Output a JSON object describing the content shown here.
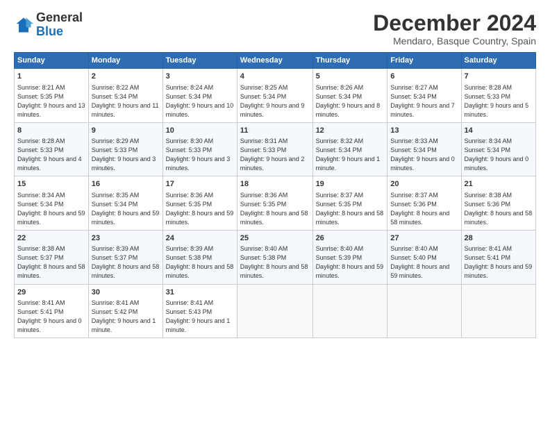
{
  "logo": {
    "line1": "General",
    "line2": "Blue"
  },
  "title": "December 2024",
  "subtitle": "Mendaro, Basque Country, Spain",
  "weekdays": [
    "Sunday",
    "Monday",
    "Tuesday",
    "Wednesday",
    "Thursday",
    "Friday",
    "Saturday"
  ],
  "weeks": [
    [
      {
        "day": "1",
        "content": "Sunrise: 8:21 AM\nSunset: 5:35 PM\nDaylight: 9 hours and 13 minutes."
      },
      {
        "day": "2",
        "content": "Sunrise: 8:22 AM\nSunset: 5:34 PM\nDaylight: 9 hours and 11 minutes."
      },
      {
        "day": "3",
        "content": "Sunrise: 8:24 AM\nSunset: 5:34 PM\nDaylight: 9 hours and 10 minutes."
      },
      {
        "day": "4",
        "content": "Sunrise: 8:25 AM\nSunset: 5:34 PM\nDaylight: 9 hours and 9 minutes."
      },
      {
        "day": "5",
        "content": "Sunrise: 8:26 AM\nSunset: 5:34 PM\nDaylight: 9 hours and 8 minutes."
      },
      {
        "day": "6",
        "content": "Sunrise: 8:27 AM\nSunset: 5:34 PM\nDaylight: 9 hours and 7 minutes."
      },
      {
        "day": "7",
        "content": "Sunrise: 8:28 AM\nSunset: 5:33 PM\nDaylight: 9 hours and 5 minutes."
      }
    ],
    [
      {
        "day": "8",
        "content": "Sunrise: 8:28 AM\nSunset: 5:33 PM\nDaylight: 9 hours and 4 minutes."
      },
      {
        "day": "9",
        "content": "Sunrise: 8:29 AM\nSunset: 5:33 PM\nDaylight: 9 hours and 3 minutes."
      },
      {
        "day": "10",
        "content": "Sunrise: 8:30 AM\nSunset: 5:33 PM\nDaylight: 9 hours and 3 minutes."
      },
      {
        "day": "11",
        "content": "Sunrise: 8:31 AM\nSunset: 5:33 PM\nDaylight: 9 hours and 2 minutes."
      },
      {
        "day": "12",
        "content": "Sunrise: 8:32 AM\nSunset: 5:34 PM\nDaylight: 9 hours and 1 minute."
      },
      {
        "day": "13",
        "content": "Sunrise: 8:33 AM\nSunset: 5:34 PM\nDaylight: 9 hours and 0 minutes."
      },
      {
        "day": "14",
        "content": "Sunrise: 8:34 AM\nSunset: 5:34 PM\nDaylight: 9 hours and 0 minutes."
      }
    ],
    [
      {
        "day": "15",
        "content": "Sunrise: 8:34 AM\nSunset: 5:34 PM\nDaylight: 8 hours and 59 minutes."
      },
      {
        "day": "16",
        "content": "Sunrise: 8:35 AM\nSunset: 5:34 PM\nDaylight: 8 hours and 59 minutes."
      },
      {
        "day": "17",
        "content": "Sunrise: 8:36 AM\nSunset: 5:35 PM\nDaylight: 8 hours and 59 minutes."
      },
      {
        "day": "18",
        "content": "Sunrise: 8:36 AM\nSunset: 5:35 PM\nDaylight: 8 hours and 58 minutes."
      },
      {
        "day": "19",
        "content": "Sunrise: 8:37 AM\nSunset: 5:35 PM\nDaylight: 8 hours and 58 minutes."
      },
      {
        "day": "20",
        "content": "Sunrise: 8:37 AM\nSunset: 5:36 PM\nDaylight: 8 hours and 58 minutes."
      },
      {
        "day": "21",
        "content": "Sunrise: 8:38 AM\nSunset: 5:36 PM\nDaylight: 8 hours and 58 minutes."
      }
    ],
    [
      {
        "day": "22",
        "content": "Sunrise: 8:38 AM\nSunset: 5:37 PM\nDaylight: 8 hours and 58 minutes."
      },
      {
        "day": "23",
        "content": "Sunrise: 8:39 AM\nSunset: 5:37 PM\nDaylight: 8 hours and 58 minutes."
      },
      {
        "day": "24",
        "content": "Sunrise: 8:39 AM\nSunset: 5:38 PM\nDaylight: 8 hours and 58 minutes."
      },
      {
        "day": "25",
        "content": "Sunrise: 8:40 AM\nSunset: 5:38 PM\nDaylight: 8 hours and 58 minutes."
      },
      {
        "day": "26",
        "content": "Sunrise: 8:40 AM\nSunset: 5:39 PM\nDaylight: 8 hours and 59 minutes."
      },
      {
        "day": "27",
        "content": "Sunrise: 8:40 AM\nSunset: 5:40 PM\nDaylight: 8 hours and 59 minutes."
      },
      {
        "day": "28",
        "content": "Sunrise: 8:41 AM\nSunset: 5:41 PM\nDaylight: 8 hours and 59 minutes."
      }
    ],
    [
      {
        "day": "29",
        "content": "Sunrise: 8:41 AM\nSunset: 5:41 PM\nDaylight: 9 hours and 0 minutes."
      },
      {
        "day": "30",
        "content": "Sunrise: 8:41 AM\nSunset: 5:42 PM\nDaylight: 9 hours and 1 minute."
      },
      {
        "day": "31",
        "content": "Sunrise: 8:41 AM\nSunset: 5:43 PM\nDaylight: 9 hours and 1 minute."
      },
      {
        "day": "",
        "content": ""
      },
      {
        "day": "",
        "content": ""
      },
      {
        "day": "",
        "content": ""
      },
      {
        "day": "",
        "content": ""
      }
    ]
  ]
}
